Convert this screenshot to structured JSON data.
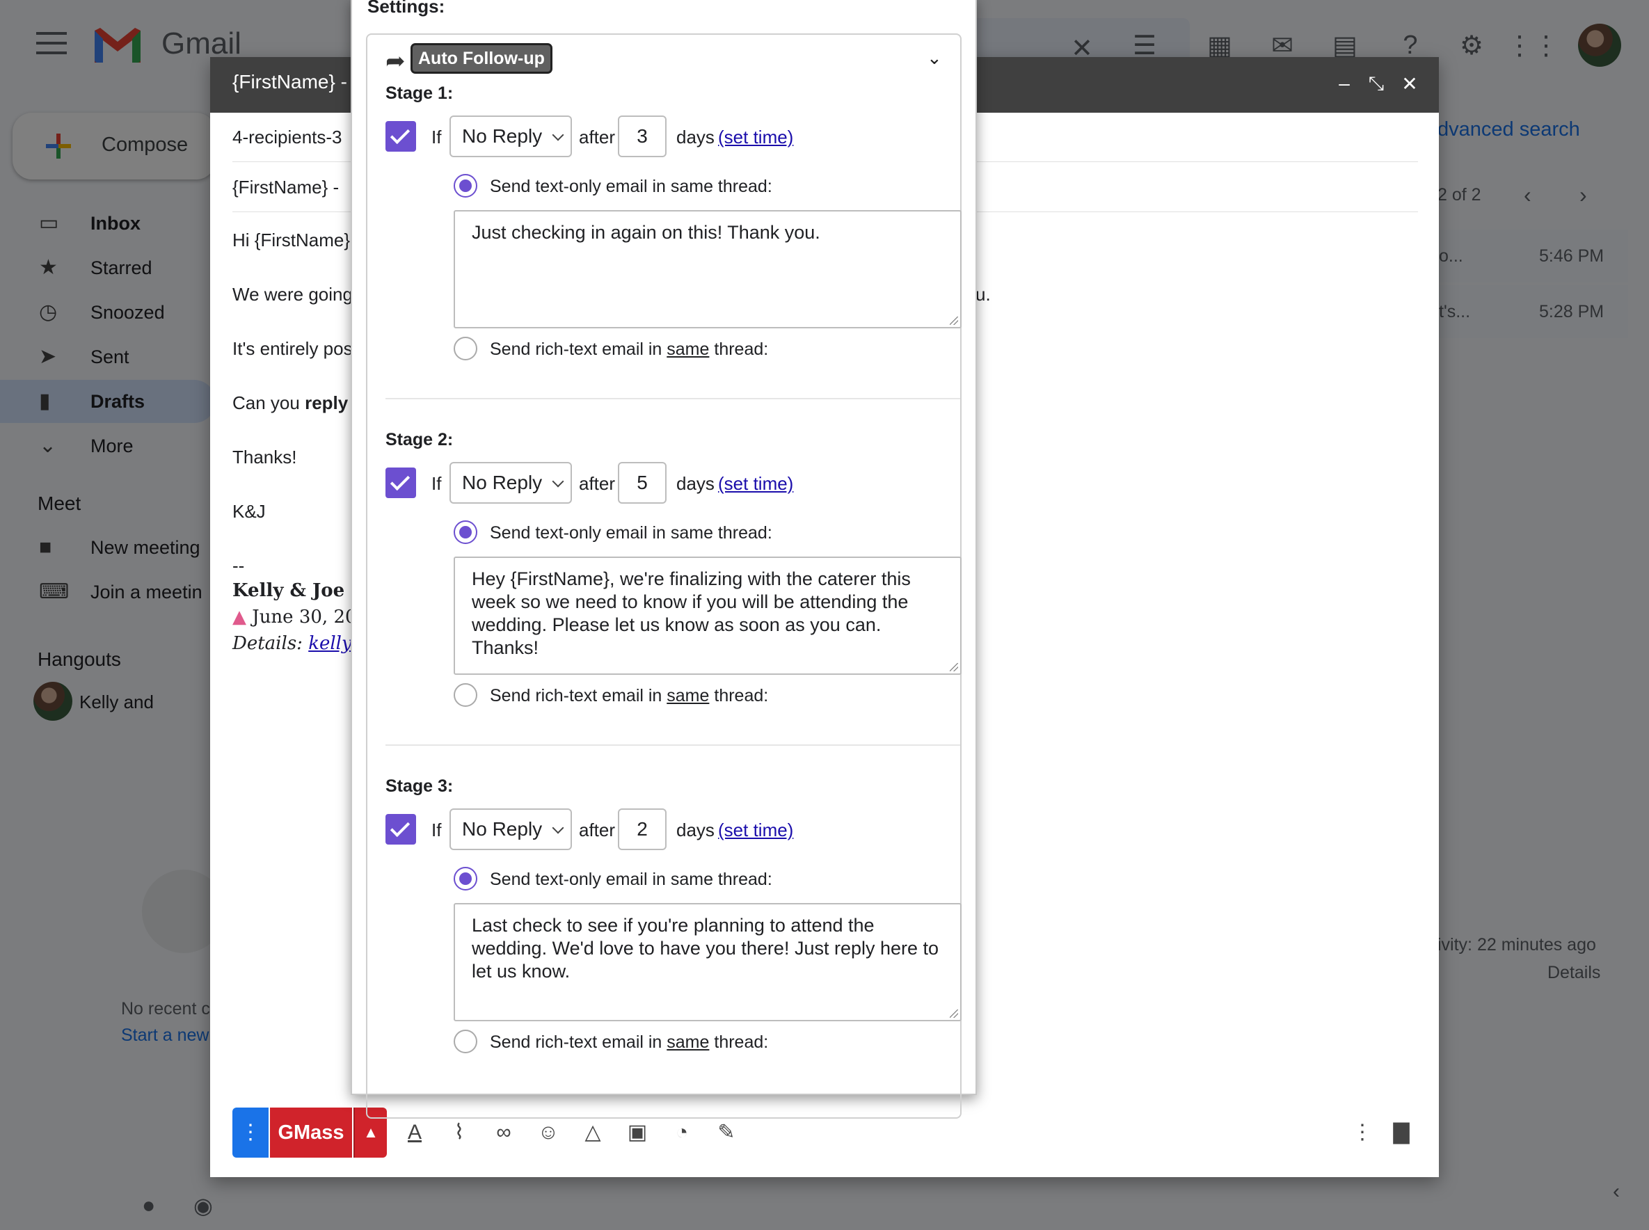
{
  "app": {
    "name": "Gmail"
  },
  "sidebar": {
    "compose_label": "Compose",
    "items": [
      {
        "label": "Inbox",
        "icon": "inbox-icon"
      },
      {
        "label": "Starred",
        "icon": "star-icon"
      },
      {
        "label": "Snoozed",
        "icon": "clock-icon"
      },
      {
        "label": "Sent",
        "icon": "send-icon"
      },
      {
        "label": "Drafts",
        "icon": "draft-icon"
      },
      {
        "label": "More",
        "icon": "chevron-down-icon"
      }
    ],
    "meet": {
      "header": "Meet",
      "new_meeting": "New meeting",
      "join": "Join a meetin"
    },
    "hangouts": {
      "header": "Hangouts",
      "user": "Kelly and",
      "no_recent": "No recent c",
      "start_new": "Start a new"
    }
  },
  "main_bg": {
    "advanced_search": "dvanced search",
    "pagination": "2 of 2",
    "rows": [
      {
        "snippet": "o...",
        "time": "5:46 PM"
      },
      {
        "snippet": "t's...",
        "time": "5:28 PM"
      }
    ],
    "activity": "ivity: 22 minutes ago",
    "details": "Details"
  },
  "compose": {
    "title": "{FirstName} -",
    "recipients": "4-recipients-3",
    "subject": "{FirstName} -",
    "body": [
      "Hi {FirstName}",
      "We were going",
      "It's entirely pos",
      "Can you ",
      "Thanks!",
      "K&J",
      "--"
    ],
    "body_bold": "reply",
    "body_tail": "u.",
    "signature": {
      "name": "Kelly & Joe",
      "date": "June 30, 20",
      "details_label": "Details:",
      "details_link": "kellya"
    },
    "send_button": "GMass"
  },
  "settings": {
    "heading": "Settings:",
    "feature": "Auto Follow-up",
    "stages": [
      {
        "label": "Stage 1:",
        "if": "If",
        "condition": "No Reply",
        "after": "after",
        "days": "3",
        "days_label": "days",
        "set_time": "(set time)",
        "text_option": "Send text-only email in same thread:",
        "message": "Just checking in again on this! Thank you.",
        "rich_a": "Send rich-text email in ",
        "rich_u": "same",
        "rich_b": " thread:"
      },
      {
        "label": "Stage 2:",
        "if": "If",
        "condition": "No Reply",
        "after": "after",
        "days": "5",
        "days_label": "days",
        "set_time": "(set time)",
        "text_option": "Send text-only email in same thread:",
        "message": "Hey {FirstName}, we're finalizing with the caterer this week so we need to know if you will be attending the wedding. Please let us know as soon as you can. Thanks!",
        "rich_a": "Send rich-text email in ",
        "rich_u": "same",
        "rich_b": " thread:"
      },
      {
        "label": "Stage 3:",
        "if": "If",
        "condition": "No Reply",
        "after": "after",
        "days": "2",
        "days_label": "days",
        "set_time": "(set time)",
        "text_option": "Send text-only email in same thread:",
        "message": "Last check to see if you're planning to attend the wedding. We'd love to have you there! Just reply here to let us know.",
        "rich_a": "Send rich-text email in ",
        "rich_u": "same",
        "rich_b": " thread:"
      }
    ]
  },
  "colors": {
    "accent": "#6c4fd0",
    "gmass": "#d0232b",
    "link": "#1a0dab"
  }
}
